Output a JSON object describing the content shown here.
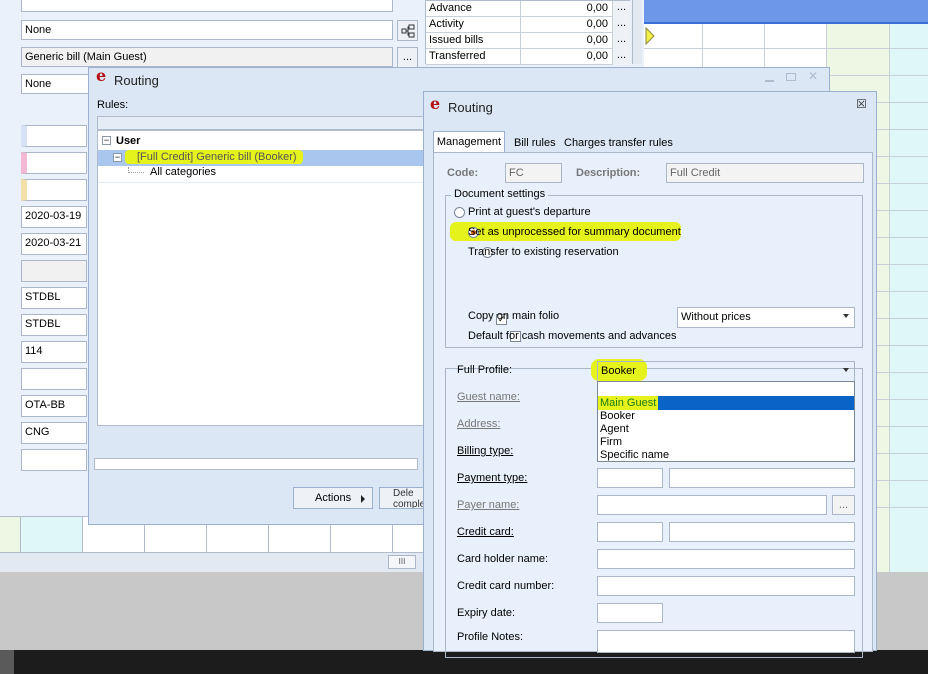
{
  "background": {
    "fields": [
      "None",
      "Generic bill (Main Guest)",
      "None"
    ],
    "left_fields": [
      "",
      "",
      "",
      "2020-03-19",
      "2020-03-21",
      "",
      "STDBL",
      "STDBL",
      "114",
      "",
      "OTA-BB",
      "CNG",
      ""
    ],
    "payments": [
      {
        "label": "Advance payments",
        "value": "0,00"
      },
      {
        "label": "Activity",
        "value": "0,00"
      },
      {
        "label": "Issued bills",
        "value": "0,00"
      },
      {
        "label": "Transferred",
        "value": "0,00"
      }
    ],
    "dots": "...",
    "scroll_grip": "III"
  },
  "routing_window": {
    "title": "Routing",
    "rules_label": "Rules:",
    "tree": {
      "root": "User",
      "rule": "[Full Credit] Generic bill (Booker)",
      "child": "All categories"
    },
    "actions_button": "Actions",
    "delete_button": "Dele\ncomple"
  },
  "routing_dialog": {
    "title": "Routing",
    "tabs": [
      "Management",
      "Bill rules",
      "Charges transfer rules"
    ],
    "code_label": "Code:",
    "code_value": "FC",
    "description_label": "Description:",
    "description_value": "Full Credit",
    "document_settings": {
      "legend": "Document settings",
      "options": [
        "Print at guest's departure",
        "Set as unprocessed for summary document",
        "Transfer to existing reservation"
      ],
      "selected_index": 1,
      "copy_on_main_folio": "Copy on main folio",
      "copy_checked": true,
      "prices_select": "Without prices",
      "default_cash": "Default for cash movements and advances",
      "default_checked": false
    },
    "profile": {
      "full_profile_label": "Full Profile:",
      "full_profile_value": "Booker",
      "dropdown_options": [
        "Main Guest",
        "Booker",
        "Agent",
        "Firm",
        "Specific name"
      ],
      "dropdown_selected": "Main Guest",
      "guest_name_label": "Guest name:",
      "address_label": "Address:",
      "billing_type_label": "Billing type:",
      "payment_type_label": "Payment type:",
      "payer_name_label": "Payer name:",
      "credit_card_label": "Credit card:",
      "card_holder_label": "Card holder name:",
      "card_number_label": "Credit card number:",
      "expiry_label": "Expiry date:",
      "notes_label": "Profile Notes:"
    }
  },
  "colors": {
    "highlight": "#e6f21b",
    "selection": "#0a64c8",
    "selected_text": "#1a7a1a",
    "logo": "#b31212"
  }
}
